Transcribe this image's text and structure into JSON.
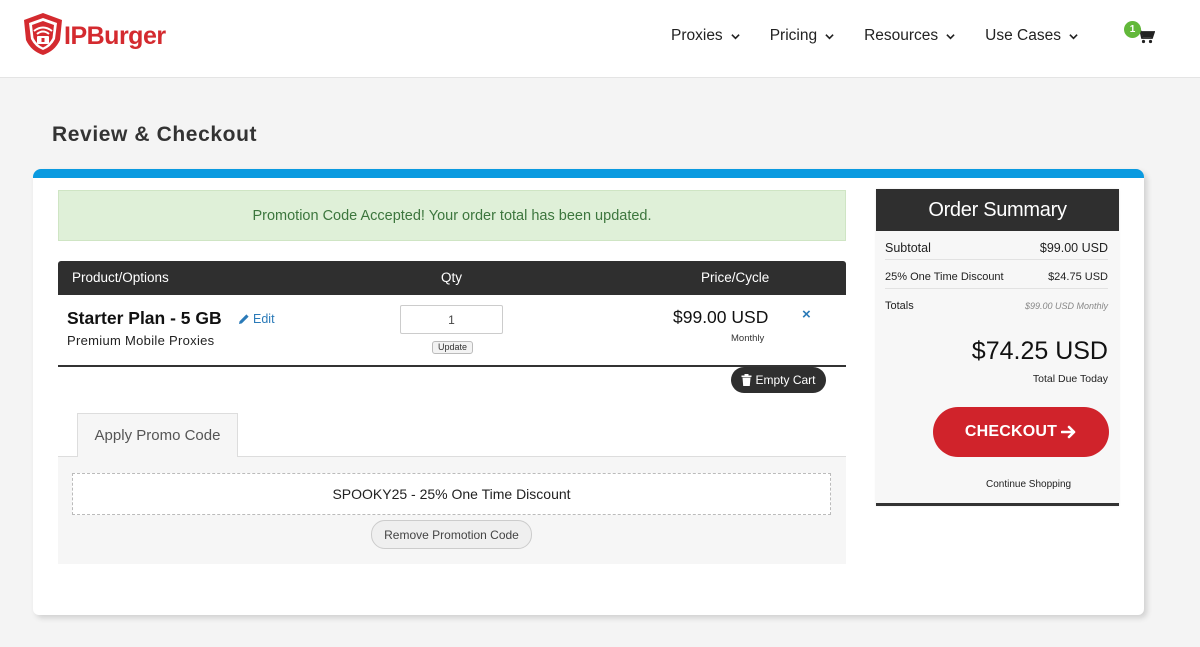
{
  "brand": {
    "name": "IPBurger",
    "color": "#d42a2f"
  },
  "nav": {
    "items": [
      {
        "label": "Proxies"
      },
      {
        "label": "Pricing"
      },
      {
        "label": "Resources"
      },
      {
        "label": "Use Cases"
      }
    ],
    "cart_count": "1"
  },
  "page": {
    "title": "Review & Checkout"
  },
  "alert": {
    "message": "Promotion Code Accepted! Your order total has been updated."
  },
  "cart_table": {
    "headers": {
      "product": "Product/Options",
      "qty": "Qty",
      "price": "Price/Cycle"
    },
    "item": {
      "name": "Starter Plan - 5 GB",
      "edit_label": "Edit",
      "description": "Premium Mobile Proxies",
      "qty": "1",
      "update_label": "Update",
      "price": "$99.00 USD",
      "cycle": "Monthly",
      "remove_symbol": "×"
    },
    "empty_cart_label": "Empty Cart"
  },
  "promo": {
    "tab_label": "Apply Promo Code",
    "applied_code": "SPOOKY25 - 25% One Time Discount",
    "remove_label": "Remove Promotion Code"
  },
  "summary": {
    "title": "Order Summary",
    "subtotal_label": "Subtotal",
    "subtotal_value": "$99.00 USD",
    "discount_label": "25% One Time Discount",
    "discount_value": "$24.75 USD",
    "totals_label": "Totals",
    "totals_value": "$99.00 USD Monthly",
    "total_due": "$74.25 USD",
    "total_due_label": "Total Due Today",
    "checkout_label": "CHECKOUT",
    "continue_label": "Continue Shopping"
  },
  "colors": {
    "accent_blue": "#0a9ae0",
    "checkout_red": "#d0232b",
    "alert_green_bg": "#dff0d8",
    "alert_green_text": "#3c763d",
    "dark_header": "#2f2f2f",
    "link_blue": "#2a7ab8",
    "badge_green": "#62b83a"
  },
  "icons": [
    "shield-lock-icon",
    "chevron-down-icon",
    "cart-icon",
    "pencil-icon",
    "close-icon",
    "trash-icon",
    "arrow-right-icon"
  ]
}
